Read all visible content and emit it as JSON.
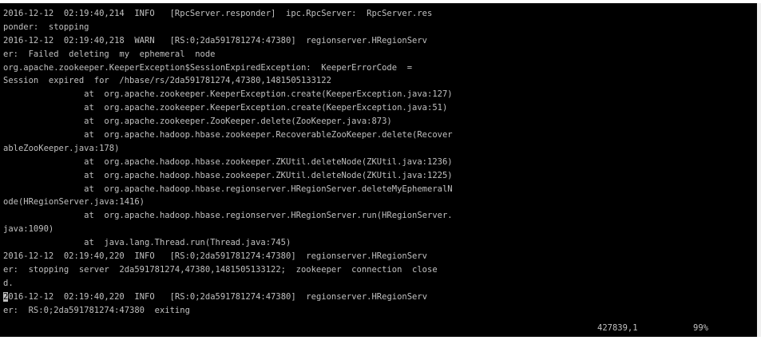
{
  "terminal": {
    "lines": [
      "2016-12-12  02:19:40,214  INFO   [RpcServer.responder]  ipc.RpcServer:  RpcServer.res",
      "ponder:  stopping",
      "2016-12-12  02:19:40,218  WARN   [RS:0;2da591781274:47380]  regionserver.HRegionServ",
      "er:  Failed  deleting  my  ephemeral  node",
      "org.apache.zookeeper.KeeperException$SessionExpiredException:  KeeperErrorCode  =",
      "Session  expired  for  /hbase/rs/2da591781274,47380,1481505133122",
      "                at  org.apache.zookeeper.KeeperException.create(KeeperException.java:127)",
      "                at  org.apache.zookeeper.KeeperException.create(KeeperException.java:51)",
      "                at  org.apache.zookeeper.ZooKeeper.delete(ZooKeeper.java:873)",
      "                at  org.apache.hadoop.hbase.zookeeper.RecoverableZooKeeper.delete(Recover",
      "ableZooKeeper.java:178)",
      "                at  org.apache.hadoop.hbase.zookeeper.ZKUtil.deleteNode(ZKUtil.java:1236)",
      "                at  org.apache.hadoop.hbase.zookeeper.ZKUtil.deleteNode(ZKUtil.java:1225)",
      "                at  org.apache.hadoop.hbase.regionserver.HRegionServer.deleteMyEphemeralN",
      "ode(HRegionServer.java:1416)",
      "                at  org.apache.hadoop.hbase.regionserver.HRegionServer.run(HRegionServer.",
      "java:1090)",
      "                at  java.lang.Thread.run(Thread.java:745)",
      "2016-12-12  02:19:40,220  INFO   [RS:0;2da591781274:47380]  regionserver.HRegionServ",
      "er:  stopping  server  2da591781274,47380,1481505133122;  zookeeper  connection  close",
      "d.",
      "2016-12-12  02:19:40,220  INFO   [RS:0;2da591781274:47380]  regionserver.HRegionServ",
      "er:  RS:0;2da591781274:47380  exiting"
    ],
    "cursor_line": 21
  },
  "status": {
    "position": "427839,1",
    "percent": "99%"
  },
  "colors": {
    "background": "#000000",
    "foreground": "#c0c0c0"
  }
}
